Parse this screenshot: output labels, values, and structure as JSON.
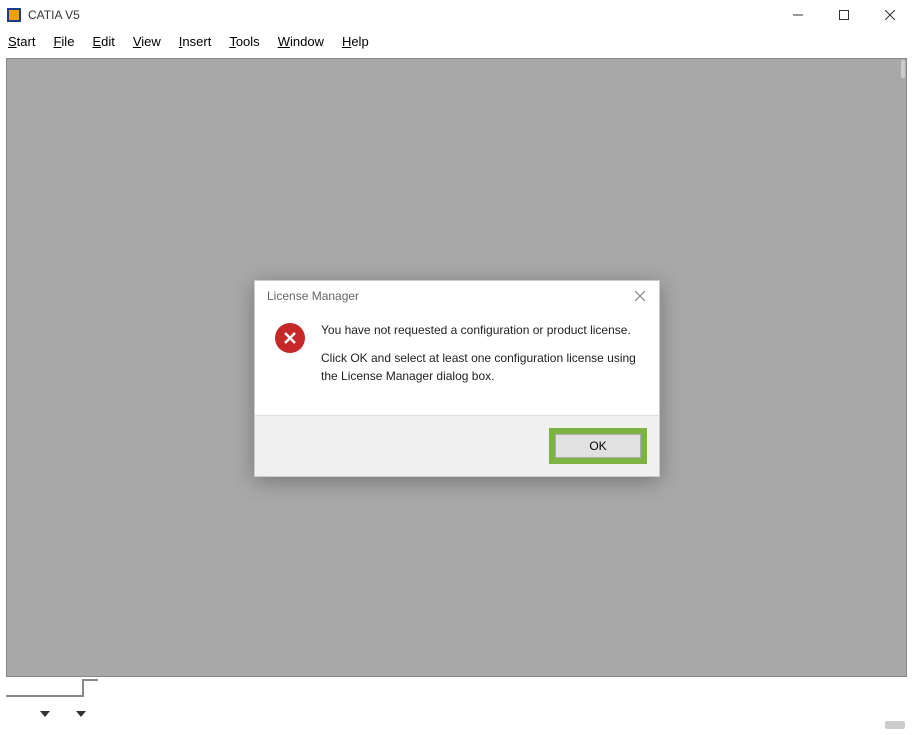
{
  "window": {
    "title": "CATIA V5"
  },
  "menu": {
    "items": [
      {
        "pre": "S",
        "post": "tart"
      },
      {
        "pre": "F",
        "post": "ile"
      },
      {
        "pre": "E",
        "post": "dit"
      },
      {
        "pre": "V",
        "post": "iew"
      },
      {
        "pre": "I",
        "post": "nsert"
      },
      {
        "pre": "T",
        "post": "ools"
      },
      {
        "pre": "W",
        "post": "indow"
      },
      {
        "pre": "H",
        "post": "elp"
      }
    ]
  },
  "dialog": {
    "title": "License  Manager",
    "line1": "You have not requested a configuration or product license.",
    "line2": "Click OK and select at least one configuration license using the License Manager dialog box.",
    "ok_label": "OK"
  }
}
